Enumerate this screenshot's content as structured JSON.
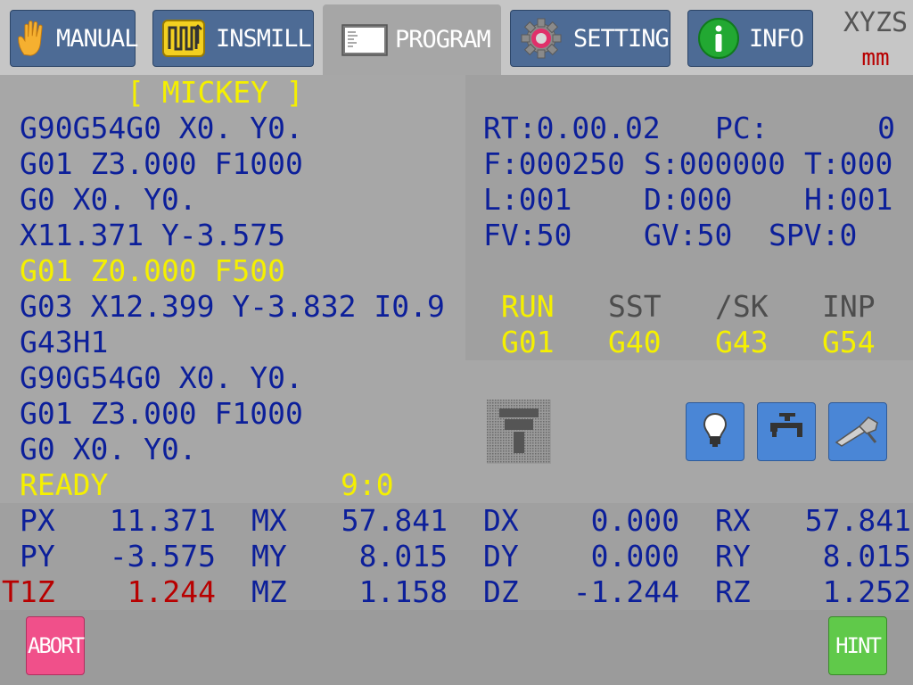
{
  "tabs": [
    {
      "label": "MANUAL",
      "icon": "hand-icon"
    },
    {
      "label": "INSMILL",
      "icon": "insmill-icon"
    },
    {
      "label": "PROGRAM",
      "icon": "program-icon"
    },
    {
      "label": "SETTING",
      "icon": "gear-icon"
    },
    {
      "label": "INFO",
      "icon": "info-icon"
    }
  ],
  "active_tab": "PROGRAM",
  "units": {
    "axes": "XYZS",
    "unit": "mm"
  },
  "program": {
    "name": "[ MICKEY ]",
    "lines": [
      "G90G54G0 X0. Y0.",
      "G01 Z3.000 F1000",
      "G0 X0. Y0.",
      "X11.371 Y-3.575",
      "G01 Z0.000 F500",
      "G03 X12.399 Y-3.832 I0.9",
      "G43H1",
      "G90G54G0 X0. Y0.",
      "G01 Z3.000 F1000",
      "G0 X0. Y0."
    ],
    "current_line_index": 4,
    "state": "READY",
    "counter": "9:0"
  },
  "status": {
    "rt": "RT:0.00.02",
    "pc_label": "PC:",
    "pc_value": "0",
    "f": "F:000250",
    "s": "S:000000",
    "t": "T:000",
    "l": "L:001",
    "d": "D:000",
    "h": "H:001",
    "fv": "FV:50",
    "gv": "GV:50",
    "spv": "SPV:0"
  },
  "modal": {
    "headers": [
      "RUN",
      "SST",
      "/SK",
      "INP"
    ],
    "codes": [
      "G01",
      "G40",
      "G43",
      "G54"
    ]
  },
  "coords": [
    {
      "label": "PX",
      "value": "11.371"
    },
    {
      "label": "PY",
      "value": "-3.575"
    },
    {
      "label": "T1Z",
      "value": "1.244"
    },
    {
      "label": "MX",
      "value": "57.841"
    },
    {
      "label": "MY",
      "value": "8.015"
    },
    {
      "label": "MZ",
      "value": "1.158"
    },
    {
      "label": "DX",
      "value": "0.000"
    },
    {
      "label": "DY",
      "value": "0.000"
    },
    {
      "label": "DZ",
      "value": "-1.244"
    },
    {
      "label": "RX",
      "value": "57.841"
    },
    {
      "label": "RY",
      "value": "8.015"
    },
    {
      "label": "RZ",
      "value": "1.252"
    }
  ],
  "io_buttons": [
    "lamp-icon",
    "coolant-icon",
    "air-blow-icon"
  ],
  "buttons": {
    "abort": "ABORT",
    "hint": "HINT"
  },
  "colors": {
    "tab_bg": "#4d6b95",
    "text_blue": "#0c1f9a",
    "highlight_yellow": "#f5f000",
    "alarm_red": "#b80000",
    "abort_pink": "#f0508a",
    "hint_green": "#60c94a"
  }
}
